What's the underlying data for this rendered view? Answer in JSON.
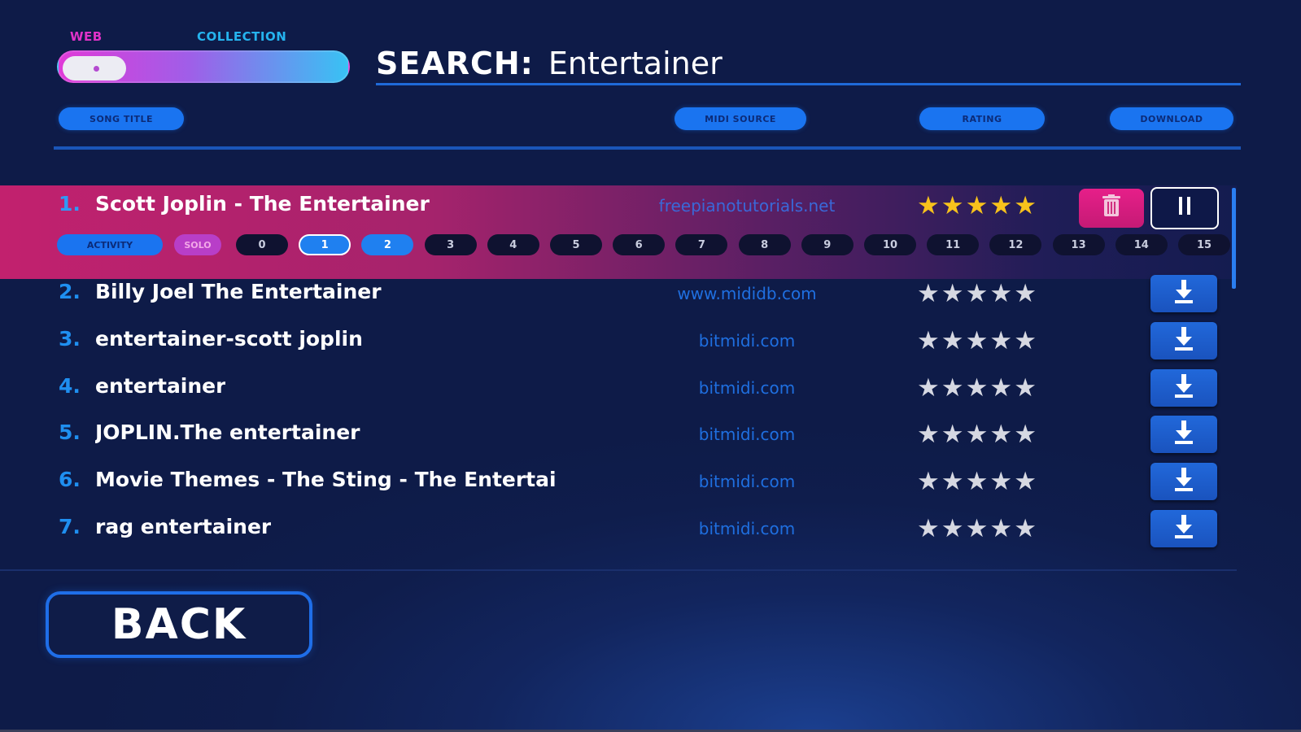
{
  "mode_toggle": {
    "left_label": "WEB",
    "right_label": "COLLECTION",
    "selected": "WEB"
  },
  "search": {
    "label": "SEARCH:",
    "term": "Entertainer"
  },
  "columns": {
    "title": "SONG TITLE",
    "source": "MIDI SOURCE",
    "rating": "RATING",
    "download": "DOWNLOAD"
  },
  "results": [
    {
      "num": "1.",
      "title": "Scott Joplin - The Entertainer",
      "source": "freepianotutorials.net",
      "rating": 4.5,
      "active": true
    },
    {
      "num": "2.",
      "title": "Billy Joel The Entertainer",
      "source": "www.mididb.com",
      "rating": 0
    },
    {
      "num": "3.",
      "title": "entertainer-scott joplin",
      "source": "bitmidi.com",
      "rating": 0
    },
    {
      "num": "4.",
      "title": "entertainer",
      "source": "bitmidi.com",
      "rating": 0
    },
    {
      "num": "5.",
      "title": "JOPLIN.The entertainer",
      "source": "bitmidi.com",
      "rating": 0
    },
    {
      "num": "6.",
      "title": "Movie Themes - The Sting - The Entertai",
      "source": "bitmidi.com",
      "rating": 0
    },
    {
      "num": "7.",
      "title": "rag entertainer",
      "source": "bitmidi.com",
      "rating": 0
    }
  ],
  "track_selector": {
    "activity_label": "ACTIVITY",
    "solo_label": "SOLO",
    "tracks": [
      "0",
      "1",
      "2",
      "3",
      "4",
      "5",
      "6",
      "7",
      "8",
      "9",
      "10",
      "11",
      "12",
      "13",
      "14",
      "15"
    ],
    "selected": "1",
    "enabled": [
      "2"
    ]
  },
  "icons": {
    "star": "star-icon",
    "download": "download-icon",
    "trash": "trash-icon",
    "pause": "pause-icon"
  },
  "colors": {
    "accent_blue": "#1a74f0",
    "accent_pink": "#e61f89",
    "star_gold": "#f7c21c",
    "star_gray": "#d6d8e2"
  },
  "back_label": "BACK"
}
